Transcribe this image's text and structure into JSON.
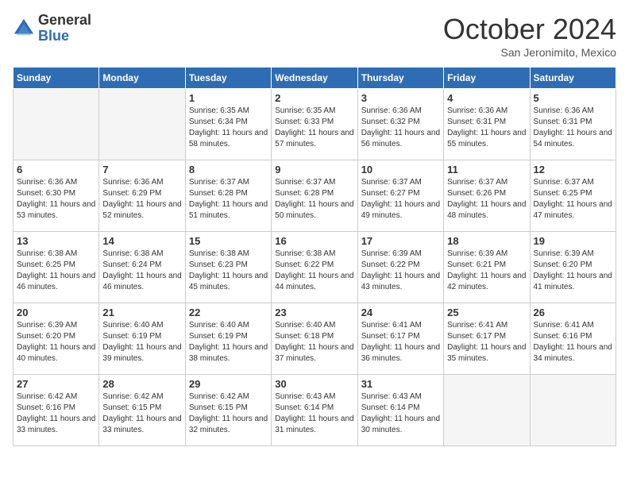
{
  "logo": {
    "general": "General",
    "blue": "Blue"
  },
  "title": "October 2024",
  "location": "San Jeronimito, Mexico",
  "days_of_week": [
    "Sunday",
    "Monday",
    "Tuesday",
    "Wednesday",
    "Thursday",
    "Friday",
    "Saturday"
  ],
  "weeks": [
    [
      {
        "day": "",
        "empty": true
      },
      {
        "day": "",
        "empty": true
      },
      {
        "day": "1",
        "sunrise": "Sunrise: 6:35 AM",
        "sunset": "Sunset: 6:34 PM",
        "daylight": "Daylight: 11 hours and 58 minutes."
      },
      {
        "day": "2",
        "sunrise": "Sunrise: 6:35 AM",
        "sunset": "Sunset: 6:33 PM",
        "daylight": "Daylight: 11 hours and 57 minutes."
      },
      {
        "day": "3",
        "sunrise": "Sunrise: 6:36 AM",
        "sunset": "Sunset: 6:32 PM",
        "daylight": "Daylight: 11 hours and 56 minutes."
      },
      {
        "day": "4",
        "sunrise": "Sunrise: 6:36 AM",
        "sunset": "Sunset: 6:31 PM",
        "daylight": "Daylight: 11 hours and 55 minutes."
      },
      {
        "day": "5",
        "sunrise": "Sunrise: 6:36 AM",
        "sunset": "Sunset: 6:31 PM",
        "daylight": "Daylight: 11 hours and 54 minutes."
      }
    ],
    [
      {
        "day": "6",
        "sunrise": "Sunrise: 6:36 AM",
        "sunset": "Sunset: 6:30 PM",
        "daylight": "Daylight: 11 hours and 53 minutes."
      },
      {
        "day": "7",
        "sunrise": "Sunrise: 6:36 AM",
        "sunset": "Sunset: 6:29 PM",
        "daylight": "Daylight: 11 hours and 52 minutes."
      },
      {
        "day": "8",
        "sunrise": "Sunrise: 6:37 AM",
        "sunset": "Sunset: 6:28 PM",
        "daylight": "Daylight: 11 hours and 51 minutes."
      },
      {
        "day": "9",
        "sunrise": "Sunrise: 6:37 AM",
        "sunset": "Sunset: 6:28 PM",
        "daylight": "Daylight: 11 hours and 50 minutes."
      },
      {
        "day": "10",
        "sunrise": "Sunrise: 6:37 AM",
        "sunset": "Sunset: 6:27 PM",
        "daylight": "Daylight: 11 hours and 49 minutes."
      },
      {
        "day": "11",
        "sunrise": "Sunrise: 6:37 AM",
        "sunset": "Sunset: 6:26 PM",
        "daylight": "Daylight: 11 hours and 48 minutes."
      },
      {
        "day": "12",
        "sunrise": "Sunrise: 6:37 AM",
        "sunset": "Sunset: 6:25 PM",
        "daylight": "Daylight: 11 hours and 47 minutes."
      }
    ],
    [
      {
        "day": "13",
        "sunrise": "Sunrise: 6:38 AM",
        "sunset": "Sunset: 6:25 PM",
        "daylight": "Daylight: 11 hours and 46 minutes."
      },
      {
        "day": "14",
        "sunrise": "Sunrise: 6:38 AM",
        "sunset": "Sunset: 6:24 PM",
        "daylight": "Daylight: 11 hours and 46 minutes."
      },
      {
        "day": "15",
        "sunrise": "Sunrise: 6:38 AM",
        "sunset": "Sunset: 6:23 PM",
        "daylight": "Daylight: 11 hours and 45 minutes."
      },
      {
        "day": "16",
        "sunrise": "Sunrise: 6:38 AM",
        "sunset": "Sunset: 6:22 PM",
        "daylight": "Daylight: 11 hours and 44 minutes."
      },
      {
        "day": "17",
        "sunrise": "Sunrise: 6:39 AM",
        "sunset": "Sunset: 6:22 PM",
        "daylight": "Daylight: 11 hours and 43 minutes."
      },
      {
        "day": "18",
        "sunrise": "Sunrise: 6:39 AM",
        "sunset": "Sunset: 6:21 PM",
        "daylight": "Daylight: 11 hours and 42 minutes."
      },
      {
        "day": "19",
        "sunrise": "Sunrise: 6:39 AM",
        "sunset": "Sunset: 6:20 PM",
        "daylight": "Daylight: 11 hours and 41 minutes."
      }
    ],
    [
      {
        "day": "20",
        "sunrise": "Sunrise: 6:39 AM",
        "sunset": "Sunset: 6:20 PM",
        "daylight": "Daylight: 11 hours and 40 minutes."
      },
      {
        "day": "21",
        "sunrise": "Sunrise: 6:40 AM",
        "sunset": "Sunset: 6:19 PM",
        "daylight": "Daylight: 11 hours and 39 minutes."
      },
      {
        "day": "22",
        "sunrise": "Sunrise: 6:40 AM",
        "sunset": "Sunset: 6:19 PM",
        "daylight": "Daylight: 11 hours and 38 minutes."
      },
      {
        "day": "23",
        "sunrise": "Sunrise: 6:40 AM",
        "sunset": "Sunset: 6:18 PM",
        "daylight": "Daylight: 11 hours and 37 minutes."
      },
      {
        "day": "24",
        "sunrise": "Sunrise: 6:41 AM",
        "sunset": "Sunset: 6:17 PM",
        "daylight": "Daylight: 11 hours and 36 minutes."
      },
      {
        "day": "25",
        "sunrise": "Sunrise: 6:41 AM",
        "sunset": "Sunset: 6:17 PM",
        "daylight": "Daylight: 11 hours and 35 minutes."
      },
      {
        "day": "26",
        "sunrise": "Sunrise: 6:41 AM",
        "sunset": "Sunset: 6:16 PM",
        "daylight": "Daylight: 11 hours and 34 minutes."
      }
    ],
    [
      {
        "day": "27",
        "sunrise": "Sunrise: 6:42 AM",
        "sunset": "Sunset: 6:16 PM",
        "daylight": "Daylight: 11 hours and 33 minutes."
      },
      {
        "day": "28",
        "sunrise": "Sunrise: 6:42 AM",
        "sunset": "Sunset: 6:15 PM",
        "daylight": "Daylight: 11 hours and 33 minutes."
      },
      {
        "day": "29",
        "sunrise": "Sunrise: 6:42 AM",
        "sunset": "Sunset: 6:15 PM",
        "daylight": "Daylight: 11 hours and 32 minutes."
      },
      {
        "day": "30",
        "sunrise": "Sunrise: 6:43 AM",
        "sunset": "Sunset: 6:14 PM",
        "daylight": "Daylight: 11 hours and 31 minutes."
      },
      {
        "day": "31",
        "sunrise": "Sunrise: 6:43 AM",
        "sunset": "Sunset: 6:14 PM",
        "daylight": "Daylight: 11 hours and 30 minutes."
      },
      {
        "day": "",
        "empty": true
      },
      {
        "day": "",
        "empty": true
      }
    ]
  ]
}
